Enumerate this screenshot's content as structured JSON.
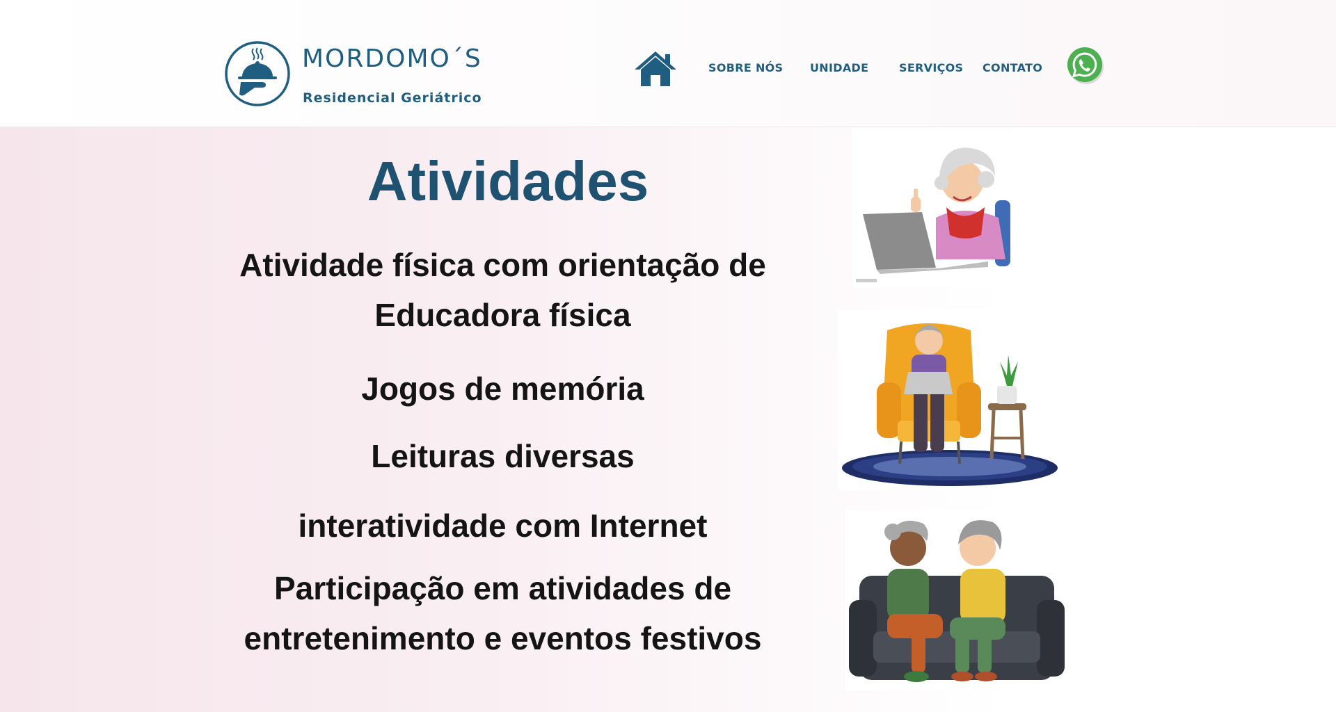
{
  "brand": {
    "name": "MORDOMO´S",
    "tagline": "Residencial Geriátrico",
    "logo_icon": "cloche-serving-icon",
    "color": "#1f5e80"
  },
  "nav": {
    "home_icon": "home-icon",
    "items": [
      {
        "label": "SOBRE NÓS"
      },
      {
        "label": "UNIDADE"
      },
      {
        "label": "SERVIÇOS"
      },
      {
        "label": "CONTATO"
      }
    ],
    "whatsapp_icon": "whatsapp-icon",
    "whatsapp_color": "#4caf50"
  },
  "main": {
    "title": "Atividades",
    "activities": [
      {
        "text": "Atividade física com orientação de Educadora física"
      },
      {
        "text": "Jogos de memória"
      },
      {
        "text": "Leituras diversas"
      },
      {
        "text": "interatividade com Internet"
      },
      {
        "text": "Participação em atividades de entretenimento e eventos festivos"
      }
    ],
    "illustrations": [
      {
        "name": "elderly-woman-laptop-thumbs-up"
      },
      {
        "name": "elderly-woman-armchair-laptop"
      },
      {
        "name": "two-elderly-women-sofa-chatting"
      }
    ]
  }
}
